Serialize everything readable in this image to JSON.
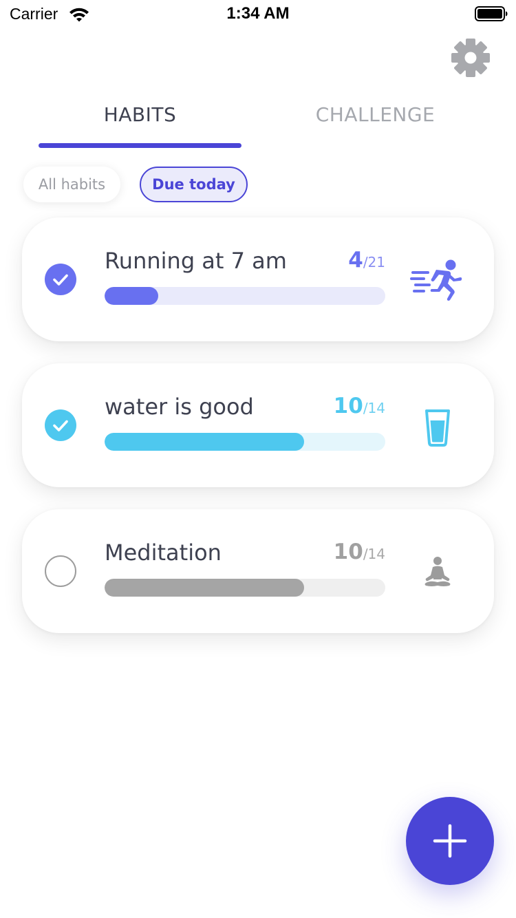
{
  "status_bar": {
    "carrier": "Carrier",
    "time": "1:34 AM",
    "icons": [
      "wifi-icon",
      "battery-icon"
    ]
  },
  "header": {
    "settings_icon": "gear-icon"
  },
  "tabs": [
    {
      "label": "HABITS",
      "active": true
    },
    {
      "label": "CHALLENGE",
      "active": false
    }
  ],
  "filters": [
    {
      "label": "All habits",
      "selected": false
    },
    {
      "label": "Due today",
      "selected": true
    }
  ],
  "habits": [
    {
      "name": "Running at 7 am",
      "done": "4",
      "total": "/21",
      "progress": 0.19,
      "checked": true,
      "icon": "running-icon",
      "accent_color": "#6870f0",
      "track_color": "#e9eafb",
      "done_color": "#6870f0",
      "total_color": "#8a8ff2"
    },
    {
      "name": "water is good",
      "done": "10",
      "total": "/14",
      "progress": 0.71,
      "checked": true,
      "icon": "water-glass-icon",
      "accent_color": "#4ec8ef",
      "track_color": "#e4f6fc",
      "done_color": "#4ec8ef",
      "total_color": "#6fd0f0"
    },
    {
      "name": "Meditation",
      "done": "10",
      "total": "/14",
      "progress": 0.71,
      "checked": false,
      "icon": "meditation-icon",
      "accent_color": "#a5a5a5",
      "track_color": "#efefef",
      "done_color": "#a0a0a0",
      "total_color": "#a8a8a8"
    }
  ],
  "fab": {
    "icon": "plus-icon",
    "color": "#4a45d6"
  }
}
